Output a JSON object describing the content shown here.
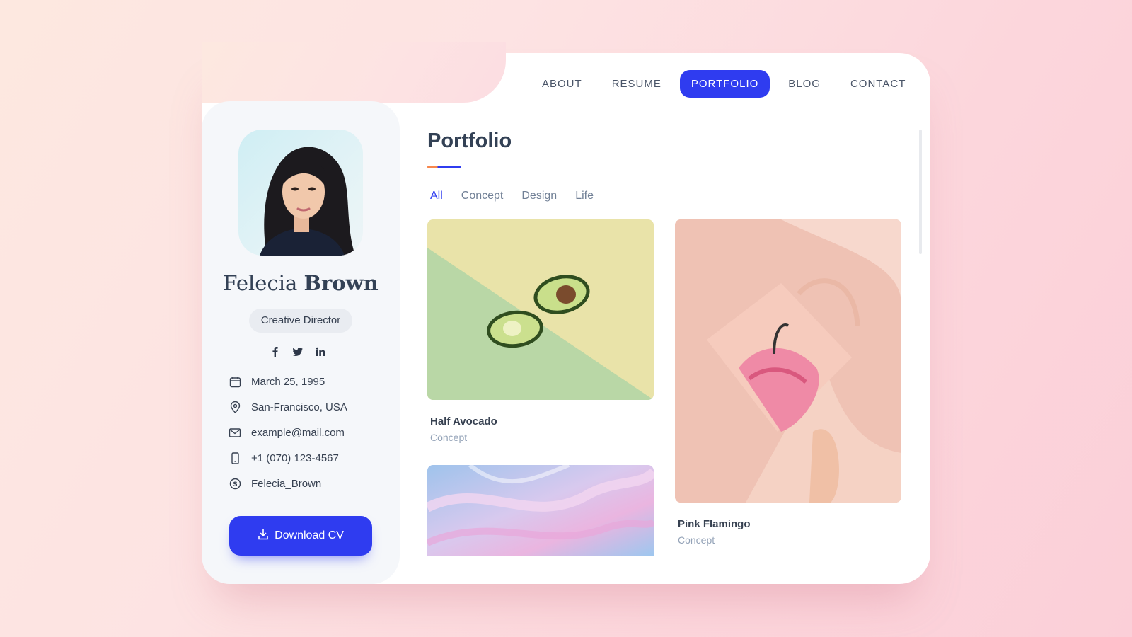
{
  "nav": {
    "items": [
      {
        "label": "ABOUT",
        "active": false
      },
      {
        "label": "RESUME",
        "active": false
      },
      {
        "label": "PORTFOLIO",
        "active": true
      },
      {
        "label": "BLOG",
        "active": false
      },
      {
        "label": "CONTACT",
        "active": false
      }
    ]
  },
  "profile": {
    "first_name": "Felecia",
    "last_name": "Brown",
    "role": "Creative Director",
    "socials": [
      "facebook-icon",
      "twitter-icon",
      "linkedin-icon"
    ],
    "info": [
      {
        "icon": "calendar-icon",
        "text": "March 25, 1995"
      },
      {
        "icon": "location-pin-icon",
        "text": "San-Francisco, USA"
      },
      {
        "icon": "mail-icon",
        "text": "example@mail.com"
      },
      {
        "icon": "phone-icon",
        "text": "+1 (070) 123-4567"
      },
      {
        "icon": "skype-icon",
        "text": "Felecia_Brown"
      }
    ],
    "download_label": "Download CV"
  },
  "portfolio": {
    "title": "Portfolio",
    "filters": [
      {
        "label": "All",
        "active": true
      },
      {
        "label": "Concept",
        "active": false
      },
      {
        "label": "Design",
        "active": false
      },
      {
        "label": "Life",
        "active": false
      }
    ],
    "items": [
      {
        "title": "Half Avocado",
        "category": "Concept"
      },
      {
        "title": "Pink Flamingo",
        "category": "Concept"
      },
      {
        "title": "",
        "category": ""
      }
    ]
  },
  "colors": {
    "accent": "#2f3cf0",
    "accent_secondary": "#f7874d",
    "text_dark": "#334155",
    "text_muted": "#94a3b8"
  }
}
